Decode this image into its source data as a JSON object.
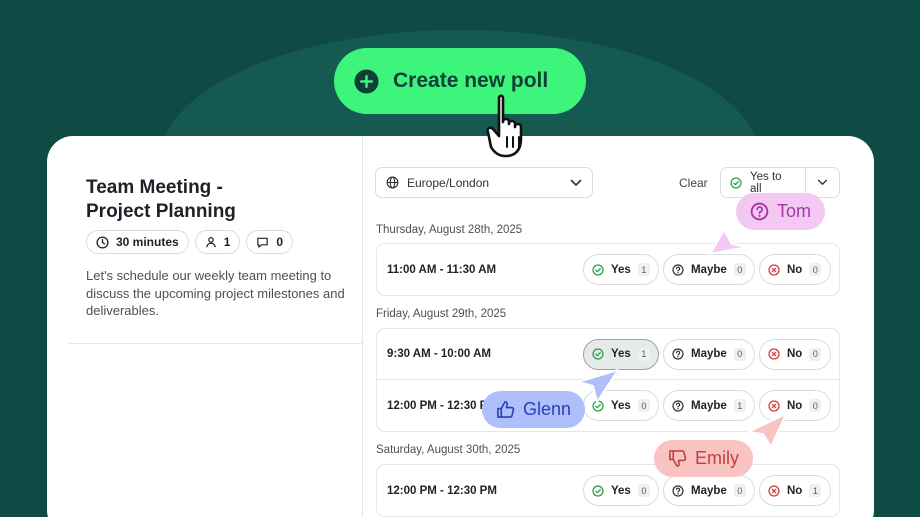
{
  "cta": {
    "label": "Create new poll"
  },
  "event": {
    "title": "Team Meeting -\nProject Planning",
    "duration": "30 minutes",
    "participants": "1",
    "comments": "0",
    "description": "Let's schedule our weekly team meeting to discuss the upcoming project milestones and deliverables."
  },
  "toolbar": {
    "timezone": "Europe/London",
    "clear_label": "Clear",
    "yes_to_all_label": "Yes to all"
  },
  "days": [
    {
      "label": "Thursday, August 28th, 2025",
      "slots": [
        {
          "time": "11:00 AM - 11:30 AM",
          "yes": "1",
          "maybe": "0",
          "no": "0"
        }
      ]
    },
    {
      "label": "Friday, August 29th, 2025",
      "slots": [
        {
          "time": "9:30 AM - 10:00 AM",
          "yes": "1",
          "maybe": "0",
          "no": "0"
        },
        {
          "time": "12:00 PM - 12:30 PM",
          "yes": "0",
          "maybe": "1",
          "no": "0"
        }
      ]
    },
    {
      "label": "Saturday, August 30th, 2025",
      "slots": [
        {
          "time": "12:00 PM - 12:30 PM",
          "yes": "0",
          "maybe": "0",
          "no": "1"
        }
      ]
    }
  ],
  "votes": {
    "yes": "Yes",
    "maybe": "Maybe",
    "no": "No"
  },
  "participants": [
    {
      "name": "Tom",
      "vote": "maybe"
    },
    {
      "name": "Glenn",
      "vote": "yes"
    },
    {
      "name": "Emily",
      "vote": "no"
    }
  ],
  "colors": {
    "background": "#0f4a44",
    "cta": "#3df57a",
    "yes": "#2fa24c",
    "no": "#d2443d",
    "tom": "#a33aa8",
    "glenn": "#2a3fb8",
    "emily": "#c4413c"
  }
}
